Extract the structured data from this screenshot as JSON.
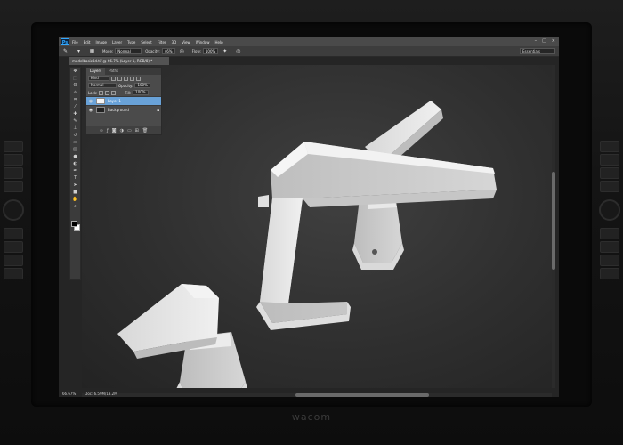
{
  "brand": "wacom",
  "menu": {
    "logo": "Ps",
    "items": [
      "File",
      "Edit",
      "Image",
      "Layer",
      "Type",
      "Select",
      "Filter",
      "3D",
      "View",
      "Window",
      "Help"
    ],
    "window_controls": [
      "–",
      "□",
      "×"
    ]
  },
  "options_bar": {
    "mode_label": "Mode:",
    "mode_value": "Normal",
    "opacity_label": "Opacity:",
    "opacity_value": "46%",
    "flow_label": "Flow:",
    "flow_value": "100%",
    "workspace": "Essentials"
  },
  "document_tab": "modelbasic3d.tif @ 66.7% (Layer 1, RGB/8) *",
  "layers_panel": {
    "tabs": [
      "Layers",
      "Paths"
    ],
    "kind_filter": "Kind",
    "blend_mode": "Normal",
    "opacity_label": "Opacity:",
    "opacity_value": "100%",
    "lock_label": "Lock:",
    "fill_label": "Fill:",
    "fill_value": "100%",
    "layers": [
      {
        "name": "Layer 1",
        "selected": true
      },
      {
        "name": "Background",
        "selected": false
      }
    ],
    "footer_icons": [
      "link-icon",
      "fx-icon",
      "mask-icon",
      "adjustment-icon",
      "folder-icon",
      "new-layer-icon",
      "trash-icon"
    ]
  },
  "status": {
    "zoom": "66.67%",
    "doc_size": "Doc: 6.59M/13.2M"
  },
  "tools": [
    "move-tool-icon",
    "marquee-tool-icon",
    "lasso-tool-icon",
    "quick-select-tool-icon",
    "crop-tool-icon",
    "eyedropper-tool-icon",
    "healing-tool-icon",
    "brush-tool-icon",
    "clone-stamp-tool-icon",
    "history-brush-tool-icon",
    "eraser-tool-icon",
    "gradient-tool-icon",
    "blur-tool-icon",
    "dodge-tool-icon",
    "pen-tool-icon",
    "type-tool-icon",
    "path-select-tool-icon",
    "shape-tool-icon",
    "hand-tool-icon",
    "zoom-tool-icon",
    "edit-toolbar-icon"
  ],
  "colors": {
    "accent": "#69a2d8",
    "ps_blue": "#31a8ff",
    "faucet_white": "#e4e4e4"
  }
}
